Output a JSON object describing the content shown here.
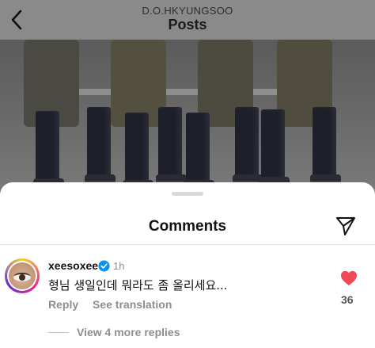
{
  "header": {
    "username": "D.O.HKYUNGSOO",
    "title": "Posts",
    "back_icon": "chevron-left-icon"
  },
  "sheet": {
    "title": "Comments",
    "share_icon": "send-icon"
  },
  "comment": {
    "username": "xeesoxee",
    "verified_icon": "verified-badge-icon",
    "time": "1h",
    "text": "형님 생일인데 뭐라도 좀 올리세요...",
    "reply_label": "Reply",
    "translate_label": "See translation",
    "like_icon": "heart-icon",
    "like_color": "#ed4956",
    "like_count": "36",
    "more_replies_label": "View 4 more replies"
  }
}
